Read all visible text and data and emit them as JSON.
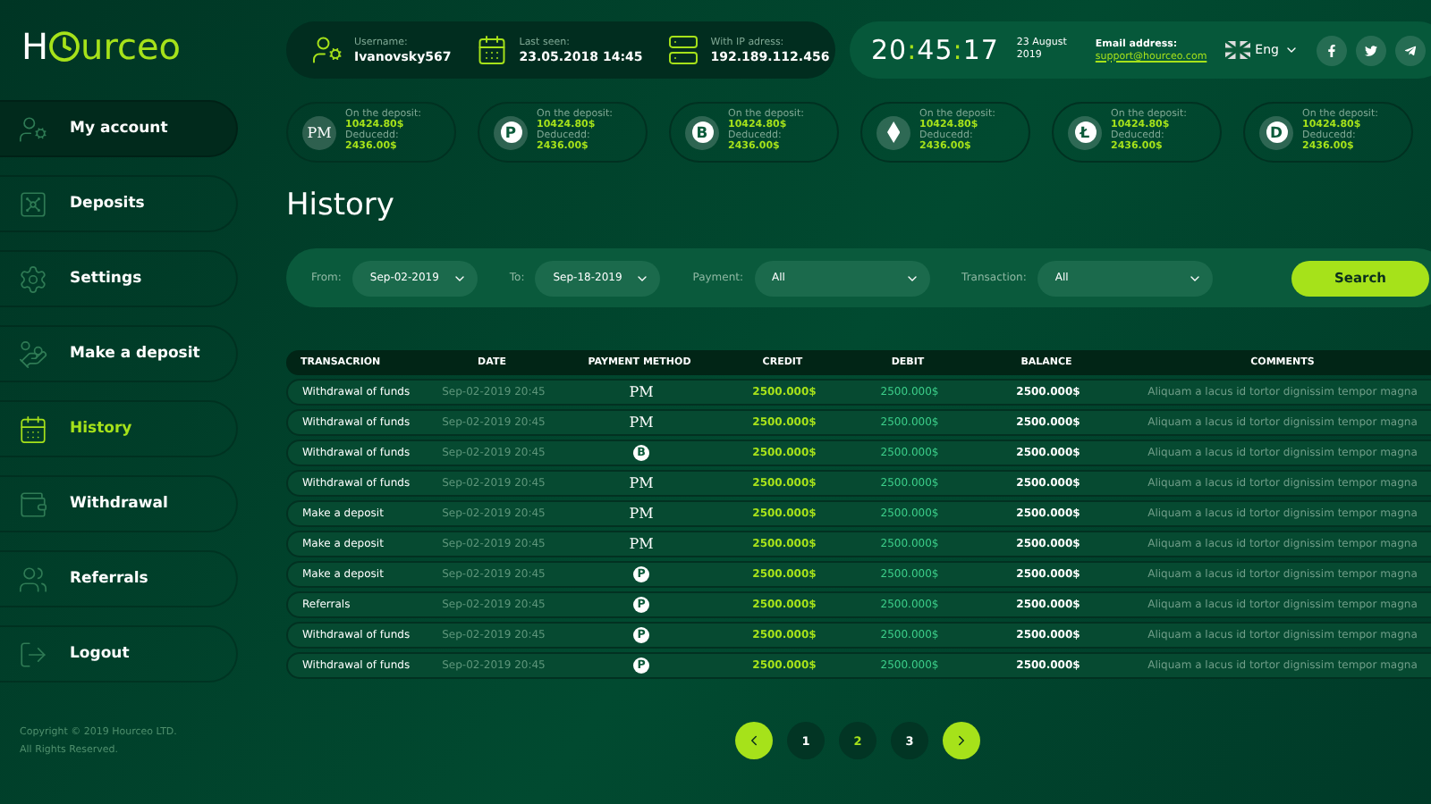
{
  "logo": {
    "prefix": "H",
    "suffix": "urceo"
  },
  "user_info": [
    {
      "kind": "user",
      "label": "Username:",
      "value": "Ivanovsky567"
    },
    {
      "kind": "calendar",
      "label": "Last seen:",
      "value": "23.05.2018  14:45"
    },
    {
      "kind": "server",
      "label": "With IP adress:",
      "value": "192.189.112.456"
    }
  ],
  "clock": {
    "time": "20:45:17",
    "date": "23 August 2019"
  },
  "email": {
    "label": "Email address:",
    "link": "support@hourceo.com"
  },
  "language": {
    "value": "Eng"
  },
  "social": [
    {
      "kind": "facebook"
    },
    {
      "kind": "twitter"
    },
    {
      "kind": "telegram"
    }
  ],
  "sidebar": {
    "items": [
      {
        "kind": "account",
        "label": "My account",
        "selected": false,
        "hovered": true
      },
      {
        "kind": "deposits",
        "label": "Deposits",
        "selected": false,
        "hovered": false
      },
      {
        "kind": "settings",
        "label": "Settings",
        "selected": false,
        "hovered": false
      },
      {
        "kind": "make",
        "label": "Make a deposit",
        "selected": false,
        "hovered": false
      },
      {
        "kind": "history",
        "label": "History",
        "selected": true,
        "hovered": false
      },
      {
        "kind": "withdrawal",
        "label": "Withdrawal",
        "selected": false,
        "hovered": false
      },
      {
        "kind": "referrals",
        "label": "Referrals",
        "selected": false,
        "hovered": false
      },
      {
        "kind": "logout",
        "label": "Logout",
        "selected": false,
        "hovered": false
      }
    ],
    "copyright": [
      "Copyright © 2019 Hourceo LTD.",
      "All Rights Reserved."
    ]
  },
  "deposits": [
    {
      "kind": "symbol",
      "symbol": "PM",
      "deposit_label": "On the deposit:",
      "deposit": "10424.80$",
      "deducted_label": "Deducedd:",
      "deducted": "2436.00$"
    },
    {
      "kind": "coin",
      "symbol": "P",
      "deposit_label": "On the deposit:",
      "deposit": "10424.80$",
      "deducted_label": "Deducedd:",
      "deducted": "2436.00$"
    },
    {
      "kind": "coin",
      "symbol": "B",
      "deposit_label": "On the deposit:",
      "deposit": "10424.80$",
      "deducted_label": "Deducedd:",
      "deducted": "2436.00$"
    },
    {
      "kind": "ethereum",
      "deposit_label": "On the deposit:",
      "deposit": "10424.80$",
      "deducted_label": "Deducedd:",
      "deducted": "2436.00$"
    },
    {
      "kind": "coin",
      "symbol": "Ł",
      "deposit_label": "On the deposit:",
      "deposit": "10424.80$",
      "deducted_label": "Deducedd:",
      "deducted": "2436.00$"
    },
    {
      "kind": "coin",
      "symbol": "D",
      "deposit_label": "On the deposit:",
      "deposit": "10424.80$",
      "deducted_label": "Deducedd:",
      "deducted": "2436.00$"
    }
  ],
  "page_title": "History",
  "filters": [
    {
      "label": "From:",
      "value": "Sep-02-2019",
      "wide": false
    },
    {
      "label": "To:",
      "value": "Sep-18-2019",
      "wide": false
    },
    {
      "label": "Payment:",
      "value": "All",
      "wide": true
    },
    {
      "label": "Transaction:",
      "value": "All",
      "wide": true
    }
  ],
  "search_button": "Search",
  "table": {
    "columns": [
      "TRANSACRION",
      "DATE",
      "PAYMENT METHOD",
      "CREDIT",
      "DEBIT",
      "BALANCE",
      "COMMENTS"
    ],
    "rows": [
      {
        "transaction": "Withdrawal of funds",
        "date": "Sep-02-2019  20:45",
        "method": {
          "kind": "symbol",
          "symbol": "PM"
        },
        "credit": "2500.000$",
        "debit": "2500.000$",
        "balance": "2500.000$",
        "comment": "Aliquam a lacus id tortor dignissim tempor magna"
      },
      {
        "transaction": "Withdrawal of funds",
        "date": "Sep-02-2019  20:45",
        "method": {
          "kind": "symbol",
          "symbol": "PM"
        },
        "credit": "2500.000$",
        "debit": "2500.000$",
        "balance": "2500.000$",
        "comment": "Aliquam a lacus id tortor dignissim tempor magna"
      },
      {
        "transaction": "Withdrawal of funds",
        "date": "Sep-02-2019  20:45",
        "method": {
          "kind": "coin",
          "symbol": "B"
        },
        "credit": "2500.000$",
        "debit": "2500.000$",
        "balance": "2500.000$",
        "comment": "Aliquam a lacus id tortor dignissim tempor magna"
      },
      {
        "transaction": "Withdrawal of funds",
        "date": "Sep-02-2019  20:45",
        "method": {
          "kind": "symbol",
          "symbol": "PM"
        },
        "credit": "2500.000$",
        "debit": "2500.000$",
        "balance": "2500.000$",
        "comment": "Aliquam a lacus id tortor dignissim tempor magna"
      },
      {
        "transaction": "Make a deposit",
        "date": "Sep-02-2019  20:45",
        "method": {
          "kind": "symbol",
          "symbol": "PM"
        },
        "credit": "2500.000$",
        "debit": "2500.000$",
        "balance": "2500.000$",
        "comment": "Aliquam a lacus id tortor dignissim tempor magna"
      },
      {
        "transaction": "Make a deposit",
        "date": "Sep-02-2019  20:45",
        "method": {
          "kind": "symbol",
          "symbol": "PM"
        },
        "credit": "2500.000$",
        "debit": "2500.000$",
        "balance": "2500.000$",
        "comment": "Aliquam a lacus id tortor dignissim tempor magna"
      },
      {
        "transaction": "Make a deposit",
        "date": "Sep-02-2019  20:45",
        "method": {
          "kind": "coin",
          "symbol": "P"
        },
        "credit": "2500.000$",
        "debit": "2500.000$",
        "balance": "2500.000$",
        "comment": "Aliquam a lacus id tortor dignissim tempor magna"
      },
      {
        "transaction": "Referrals",
        "date": "Sep-02-2019  20:45",
        "method": {
          "kind": "coin",
          "symbol": "P"
        },
        "credit": "2500.000$",
        "debit": "2500.000$",
        "balance": "2500.000$",
        "comment": "Aliquam a lacus id tortor dignissim tempor magna"
      },
      {
        "transaction": "Withdrawal of funds",
        "date": "Sep-02-2019  20:45",
        "method": {
          "kind": "coin",
          "symbol": "P"
        },
        "credit": "2500.000$",
        "debit": "2500.000$",
        "balance": "2500.000$",
        "comment": "Aliquam a lacus id tortor dignissim tempor magna"
      },
      {
        "transaction": "Withdrawal of funds",
        "date": "Sep-02-2019  20:45",
        "method": {
          "kind": "coin",
          "symbol": "P"
        },
        "credit": "2500.000$",
        "debit": "2500.000$",
        "balance": "2500.000$",
        "comment": "Aliquam a lacus id tortor dignissim tempor magna"
      }
    ]
  },
  "pagination": {
    "pages": [
      {
        "label": "1",
        "selected": false
      },
      {
        "label": "2",
        "selected": true
      },
      {
        "label": "3",
        "selected": false
      }
    ]
  }
}
